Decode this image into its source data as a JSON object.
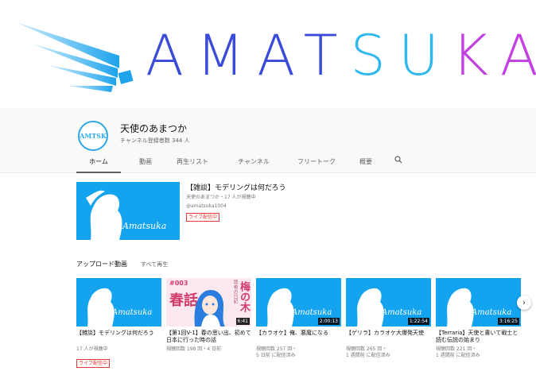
{
  "banner": {
    "text_prefix": "AMAT",
    "text_hl": "SU",
    "text_suffix": "KA"
  },
  "channel": {
    "name": "天使のあまつか",
    "subscribers": "チャンネル登録者数 344 人",
    "avatar_text": "AMTSK"
  },
  "tabs": [
    {
      "label": "ホーム",
      "active": true
    },
    {
      "label": "動画"
    },
    {
      "label": "再生リスト"
    },
    {
      "label": "チャンネル"
    },
    {
      "label": "フリートーク"
    },
    {
      "label": "概要"
    }
  ],
  "featured": {
    "title": "【雑談】モデリングは何だろう",
    "meta": "天使のあまつか・17 人が視聴中",
    "link": "@amatsuka1004",
    "badge": "ライブ配信中",
    "signature": "Amatsuka"
  },
  "uploads": {
    "title": "アップロード動画",
    "play_all": "すべて再生",
    "videos": [
      {
        "title": "【雑談】モデリングは何だろう",
        "meta1": "17 人が視聴中",
        "badge": "ライブ配信中",
        "duration": "",
        "signature": "Amatsuka"
      },
      {
        "title": "【第1回V-1】春の思い出、初めて日本に行った時の話",
        "meta1": "視聴回数 198 回・4 日前",
        "duration": "6:41",
        "thumb_text1": "#003",
        "thumb_text2": "春話",
        "thumb_text3": "梅の木"
      },
      {
        "title": "【カラオケ】俺、悪魔になる",
        "meta1": "視聴回数 257 回・",
        "meta2": "5 日前 に配信済み",
        "duration": "2:00:13",
        "signature": "Amatsuka"
      },
      {
        "title": "【ゲリラ】カラオケ大爆発天使",
        "meta1": "視聴回数 265 回・",
        "meta2": "1 週間前 に配信済み",
        "duration": "1:22:54",
        "signature": "Amatsuka"
      },
      {
        "title": "【Terraria】天使と書いて戦士と読む伝説の始まり",
        "meta1": "視聴回数 221 回・",
        "meta2": "1 週間前 に配信済み",
        "duration": "3:16:25",
        "signature": "Amatsuka"
      }
    ]
  },
  "colors": {
    "thumb_blue": "#14a3ee",
    "live_red": "#e53935",
    "banner_blue": "#3a4bd8"
  }
}
